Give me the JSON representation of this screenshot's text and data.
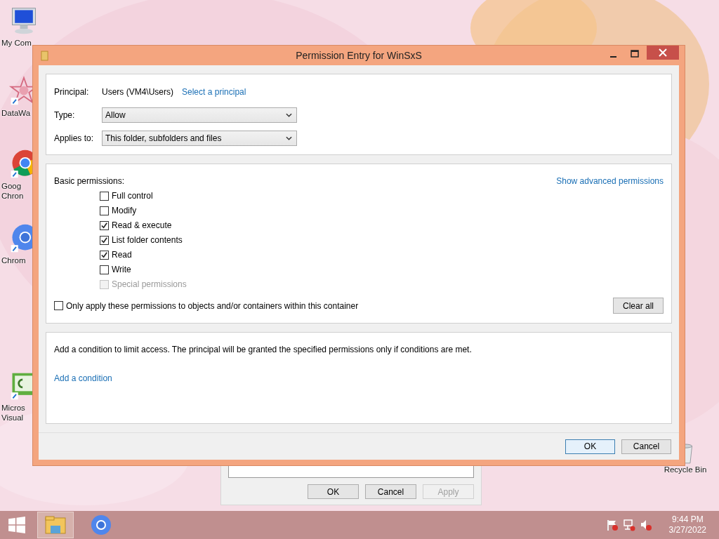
{
  "desktop_icons": [
    {
      "kind": "computer",
      "lines": [
        "My Com"
      ]
    },
    {
      "kind": "star",
      "lines": [
        "DataWa"
      ]
    },
    {
      "kind": "chrome",
      "lines": [
        "Goog",
        "Chron"
      ]
    },
    {
      "kind": "chromium",
      "lines": [
        "Chrom"
      ]
    },
    {
      "kind": "csharp",
      "lines": [
        "Micros",
        "Visual"
      ]
    }
  ],
  "recycle_bin": {
    "label": "Recycle Bin"
  },
  "background_window": {
    "buttons": [
      {
        "label": "OK",
        "disabled": false
      },
      {
        "label": "Cancel",
        "disabled": false
      },
      {
        "label": "Apply",
        "disabled": true
      }
    ]
  },
  "dialog": {
    "title": "Permission Entry for WinSxS",
    "principal": {
      "label": "Principal:",
      "value": "Users (VM4\\Users)",
      "link": "Select a principal"
    },
    "type": {
      "label": "Type:",
      "value": "Allow"
    },
    "applies_to": {
      "label": "Applies to:",
      "value": "This folder, subfolders and files"
    },
    "basic_permissions": {
      "label": "Basic permissions:",
      "advanced_link": "Show advanced permissions",
      "items": [
        {
          "label": "Full control",
          "checked": false,
          "disabled": false
        },
        {
          "label": "Modify",
          "checked": false,
          "disabled": false
        },
        {
          "label": "Read & execute",
          "checked": true,
          "disabled": false
        },
        {
          "label": "List folder contents",
          "checked": true,
          "disabled": false
        },
        {
          "label": "Read",
          "checked": true,
          "disabled": false
        },
        {
          "label": "Write",
          "checked": false,
          "disabled": false
        },
        {
          "label": "Special permissions",
          "checked": false,
          "disabled": true
        }
      ],
      "only_apply": {
        "label": "Only apply these permissions to objects and/or containers within this container",
        "checked": false
      },
      "clear_button": "Clear all"
    },
    "condition": {
      "text": "Add a condition to limit access. The principal will be granted the specified permissions only if conditions are met.",
      "link": "Add a condition"
    },
    "buttons": [
      {
        "label": "OK",
        "default": true
      },
      {
        "label": "Cancel",
        "default": false
      }
    ]
  },
  "taskbar": {
    "time": "9:44 PM",
    "date": "3/27/2022"
  }
}
